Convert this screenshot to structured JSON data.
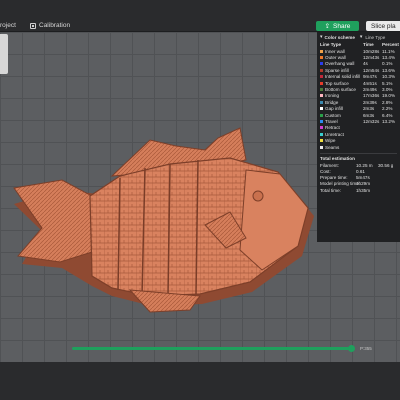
{
  "topbar": {
    "project_tab": "roject",
    "calibration_tab": "Calibration",
    "share_label": "Share",
    "slice_label": "Slice pla"
  },
  "legend": {
    "header": "Color scheme",
    "type_value": "Line Type",
    "columns": [
      "Line Type",
      "Time",
      "Percent"
    ],
    "rows": [
      {
        "label": "Inner wall",
        "time": "10m28s",
        "percent": "11.1%",
        "color": "#f0a24a"
      },
      {
        "label": "Outer wall",
        "time": "12m43s",
        "percent": "13.4%",
        "color": "#f07a2a"
      },
      {
        "label": "Overhang wall",
        "time": "4s",
        "percent": "0.1%",
        "color": "#2a3cf0"
      },
      {
        "label": "Sparse infill",
        "time": "12m54s",
        "percent": "13.6%",
        "color": "#b33a2a"
      },
      {
        "label": "Internal solid infill",
        "time": "9m47s",
        "percent": "10.3%",
        "color": "#c2283a"
      },
      {
        "label": "Top surface",
        "time": "4m51s",
        "percent": "5.1%",
        "color": "#e63c2a"
      },
      {
        "label": "Bottom surface",
        "time": "2m49s",
        "percent": "3.0%",
        "color": "#4a7a3a"
      },
      {
        "label": "Ironing",
        "time": "17m36s",
        "percent": "19.0%",
        "color": "#ffb6c1"
      },
      {
        "label": "Bridge",
        "time": "2m39s",
        "percent": "2.8%",
        "color": "#3a8ab0"
      },
      {
        "label": "Gap infill",
        "time": "2m3s",
        "percent": "2.2%",
        "color": "#ffffff"
      },
      {
        "label": "Custom",
        "time": "6m3s",
        "percent": "6.4%",
        "color": "#2aa04a"
      },
      {
        "label": "Travel",
        "time": "12m32s",
        "percent": "13.2%",
        "color": "#2a8cf0"
      },
      {
        "label": "Retract",
        "time": "",
        "percent": "",
        "color": "#d040d0"
      },
      {
        "label": "Unretract",
        "time": "",
        "percent": "",
        "color": "#3ad0d0"
      },
      {
        "label": "Wipe",
        "time": "",
        "percent": "",
        "color": "#f0e040"
      },
      {
        "label": "Seams",
        "time": "",
        "percent": "",
        "color": "#e8e8e8"
      }
    ],
    "estimation_title": "Total estimation",
    "estimation": [
      {
        "label": "Filament:",
        "v1": "10.25 m",
        "v2": "30.56 g"
      },
      {
        "label": "Cost:",
        "v1": "0.61",
        "v2": ""
      },
      {
        "label": "Prepare time:",
        "v1": "5m47s",
        "v2": ""
      },
      {
        "label": "Model printing time:",
        "v1": "1h29m",
        "v2": ""
      },
      {
        "label": "Total time:",
        "v1": "1h35m",
        "v2": ""
      }
    ]
  },
  "slider": {
    "progress": 1.0,
    "label": "P:355"
  }
}
